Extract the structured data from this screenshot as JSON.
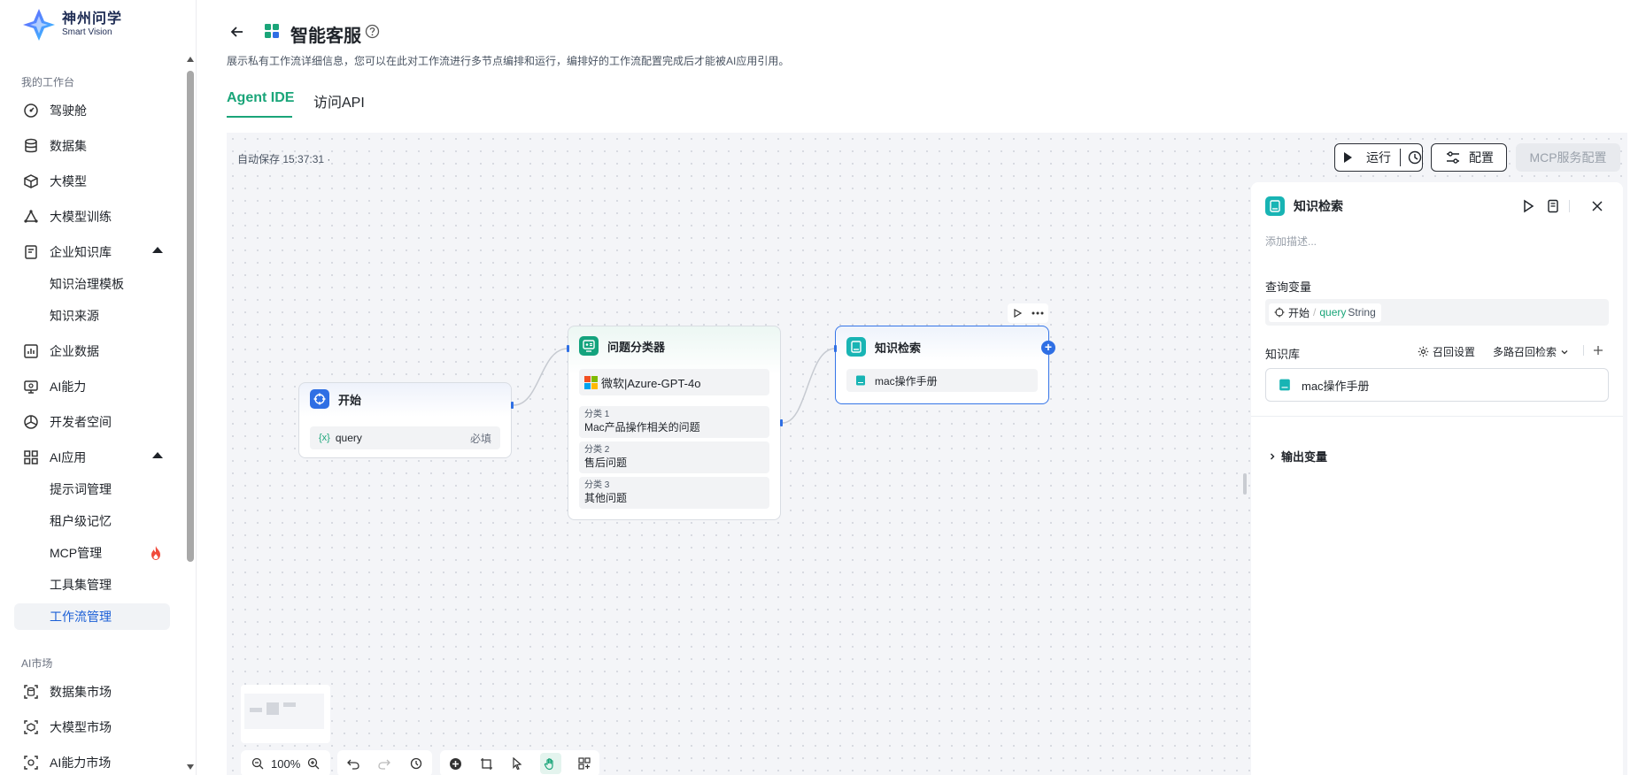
{
  "brand": {
    "name": "神州问学",
    "sub": "Smart Vision"
  },
  "sidebar": {
    "section1": "我的工作台",
    "items": [
      {
        "label": "驾驶舱",
        "icon": "dashboard-icon"
      },
      {
        "label": "数据集",
        "icon": "database-icon"
      },
      {
        "label": "大模型",
        "icon": "cube-icon"
      },
      {
        "label": "大模型训练",
        "icon": "training-icon"
      },
      {
        "label": "企业知识库",
        "icon": "knowledge-icon"
      },
      {
        "label": "企业数据",
        "icon": "chart-icon"
      },
      {
        "label": "AI能力",
        "icon": "monitor-icon"
      },
      {
        "label": "开发者空间",
        "icon": "developer-icon"
      },
      {
        "label": "AI应用",
        "icon": "apps-icon"
      }
    ],
    "kb_sub": [
      "知识治理模板",
      "知识来源"
    ],
    "app_sub": [
      "提示词管理",
      "租户级记忆",
      "MCP管理",
      "工具集管理",
      "工作流管理"
    ],
    "section2": "AI市场",
    "market": [
      {
        "label": "数据集市场",
        "icon": "dataset-market-icon"
      },
      {
        "label": "大模型市场",
        "icon": "model-market-icon"
      },
      {
        "label": "AI能力市场",
        "icon": "ai-market-icon"
      }
    ]
  },
  "header": {
    "title": "智能客服",
    "description": "展示私有工作流详细信息，您可以在此对工作流进行多节点编排和运行，编排好的工作流配置完成后才能被AI应用引用。",
    "tabs": [
      "Agent IDE",
      "访问API"
    ]
  },
  "canvas": {
    "autosave": "自动保存 15:37:31 ·",
    "run_label": "运行",
    "config_label": "配置",
    "mcp_label": "MCP服务配置",
    "zoom": "100%"
  },
  "nodes": {
    "start": {
      "title": "开始",
      "var": "query",
      "var_prefix": "{x}",
      "required": "必填"
    },
    "classifier": {
      "title": "问题分类器",
      "model": "微软|Azure-GPT-4o",
      "classes": [
        {
          "key": "分类 1",
          "value": "Mac产品操作相关的问题"
        },
        {
          "key": "分类 2",
          "value": "售后问题"
        },
        {
          "key": "分类 3",
          "value": "其他问题"
        }
      ]
    },
    "kb": {
      "title": "知识检索",
      "item": "mac操作手册"
    }
  },
  "panel": {
    "title": "知识检索",
    "desc_placeholder": "添加描述...",
    "query_label": "查询变量",
    "query_source": "开始",
    "query_sep": "/",
    "query_var": "query",
    "query_type": "String",
    "kb_label": "知识库",
    "recall_settings": "召回设置",
    "multi_recall": "多路召回检索",
    "kb_item": "mac操作手册",
    "output_label": "输出变量"
  },
  "colors": {
    "accent": "#1aa579",
    "primary": "#2f6fe4",
    "kb": "#18b4b4"
  }
}
